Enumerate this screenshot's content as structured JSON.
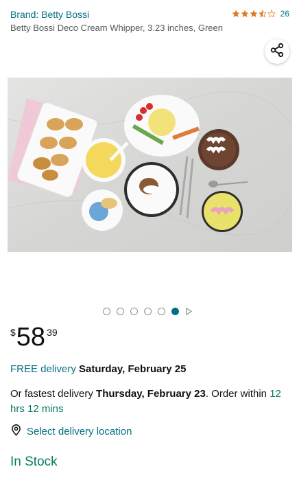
{
  "brand": "Brand: Betty Bossi",
  "rating": {
    "value": 3.5,
    "count": "26",
    "color": "#de7921"
  },
  "product_title": "Betty Bossi Deco Cream Whipper, 3.23 inches, Green",
  "share": {
    "icon": "share-icon"
  },
  "gallery": {
    "total": 6,
    "active_index": 5
  },
  "price": {
    "symbol": "$",
    "whole": "58",
    "fraction": "39"
  },
  "delivery": {
    "free_label": "FREE delivery",
    "date": "Saturday, February 25"
  },
  "fastest": {
    "prefix": "Or fastest delivery ",
    "date": "Thursday, February 23",
    "middle": ". Order within ",
    "time": "12 hrs 12 mins"
  },
  "location": {
    "label": "Select delivery location",
    "icon": "location-pin-icon"
  },
  "stock": "In Stock",
  "colors": {
    "link": "#007185",
    "success": "#067d62",
    "star": "#de7921"
  }
}
